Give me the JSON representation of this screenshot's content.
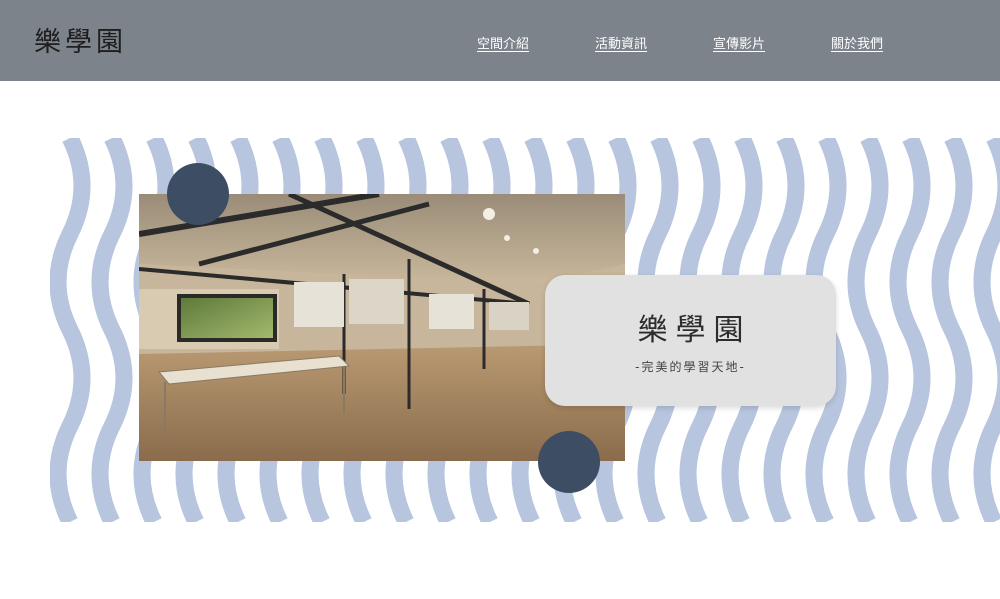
{
  "header": {
    "logo": "樂學園",
    "nav": [
      {
        "label": "空間介紹"
      },
      {
        "label": "活動資訊"
      },
      {
        "label": "宣傳影片"
      },
      {
        "label": "關於我們"
      }
    ]
  },
  "hero": {
    "title": "樂學園",
    "subtitle": "-完美的學習天地-"
  },
  "colors": {
    "header_bg": "#7c838a",
    "wave": "#b8c5df",
    "circle": "#3d4d63",
    "card_bg": "#e1e1e1"
  }
}
